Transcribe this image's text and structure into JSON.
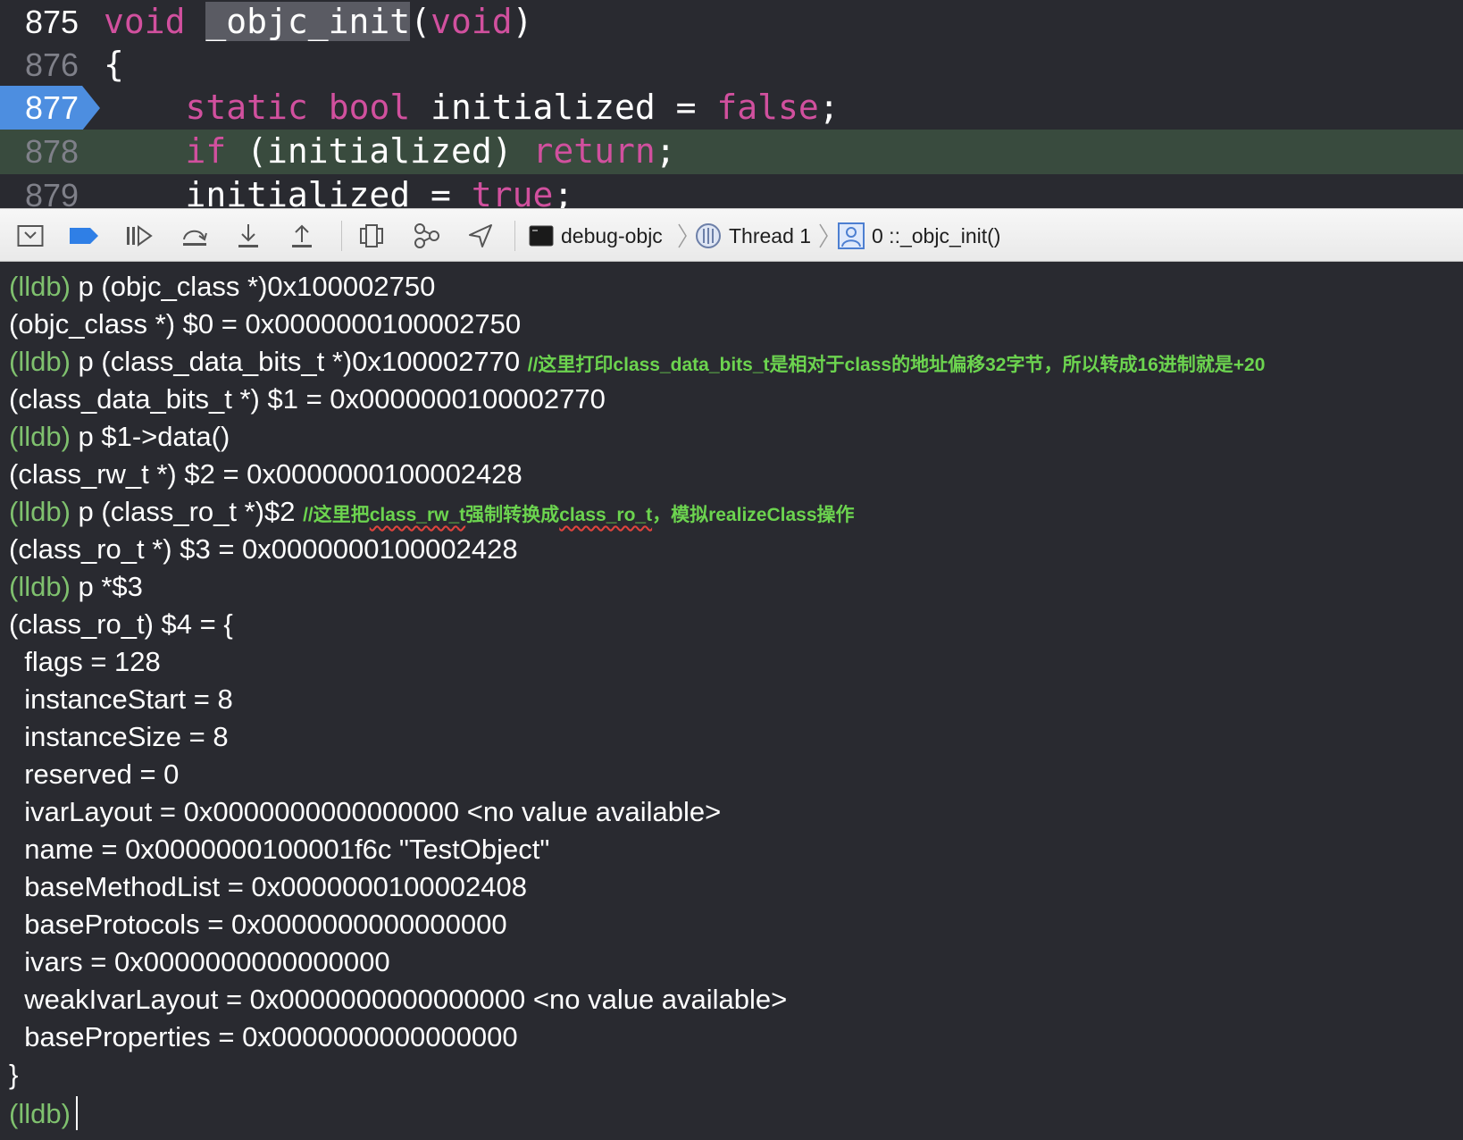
{
  "editor": {
    "lines": [
      {
        "num": "875",
        "t1": "void",
        "t2": " ",
        "t3": "_objc_init",
        "t4": "(",
        "t5": "void",
        "t6": ")"
      },
      {
        "num": "876",
        "text": "{"
      },
      {
        "num": "877",
        "t1": "    ",
        "t2": "static",
        "t3": " ",
        "t4": "bool",
        "t5": " initialized = ",
        "t6": "false",
        "t7": ";"
      },
      {
        "num": "878",
        "t1": "    ",
        "t2": "if",
        "t3": " (initialized) ",
        "t4": "return",
        "t5": ";"
      },
      {
        "num": "879",
        "t1": "    initialized = ",
        "t2": "true",
        "t3": ";"
      }
    ],
    "current_line_color": "#394b3e",
    "marker_color": "#4d8ee0",
    "keyword_color": "#d1509e"
  },
  "debugbar": {
    "icons": [
      "hide-debug-area-icon",
      "breakpoints-toggle-icon",
      "continue-icon",
      "step-over-icon",
      "step-into-icon",
      "step-out-icon",
      "view-debugger-icon",
      "memory-graph-icon",
      "simulate-location-icon"
    ],
    "breadcrumbs": {
      "target": "debug-objc",
      "thread": "Thread 1",
      "frame": "0 ::_objc_init()"
    }
  },
  "console": {
    "prompt": "(lldb)",
    "lines": [
      {
        "cmd": " p (objc_class *)0x100002750"
      },
      {
        "out": "(objc_class *) $0 = 0x0000000100002750"
      },
      {
        "cmd": " p (class_data_bits_t *)0x100002770 ",
        "comment": "//这里打印class_data_bits_t是相对于class的地址偏移32字节，所以转成16进制就是+20"
      },
      {
        "out": "(class_data_bits_t *) $1 = 0x0000000100002770"
      },
      {
        "cmd": " p $1->data()"
      },
      {
        "out": "(class_rw_t *) $2 = 0x0000000100002428"
      },
      {
        "cmd": " p (class_ro_t *)$2 ",
        "comment_a": "//这里把",
        "comment_b": "class_rw_t",
        "comment_c": "强制转换成",
        "comment_d": "class_ro_t",
        "comment_e": "，模拟realizeClass操作"
      },
      {
        "out": "(class_ro_t *) $3 = 0x0000000100002428"
      },
      {
        "cmd": " p *$3"
      },
      {
        "out": "(class_ro_t) $4 = {"
      },
      {
        "out": "  flags = 128"
      },
      {
        "out": "  instanceStart = 8"
      },
      {
        "out": "  instanceSize = 8"
      },
      {
        "out": "  reserved = 0"
      },
      {
        "out": "  ivarLayout = 0x0000000000000000 <no value available>"
      },
      {
        "out": "  name = 0x0000000100001f6c \"TestObject\""
      },
      {
        "out": "  baseMethodList = 0x0000000100002408"
      },
      {
        "out": "  baseProtocols = 0x0000000000000000"
      },
      {
        "out": "  ivars = 0x0000000000000000"
      },
      {
        "out": "  weakIvarLayout = 0x0000000000000000 <no value available>"
      },
      {
        "out": "  baseProperties = 0x0000000000000000"
      },
      {
        "out": "}"
      }
    ]
  }
}
